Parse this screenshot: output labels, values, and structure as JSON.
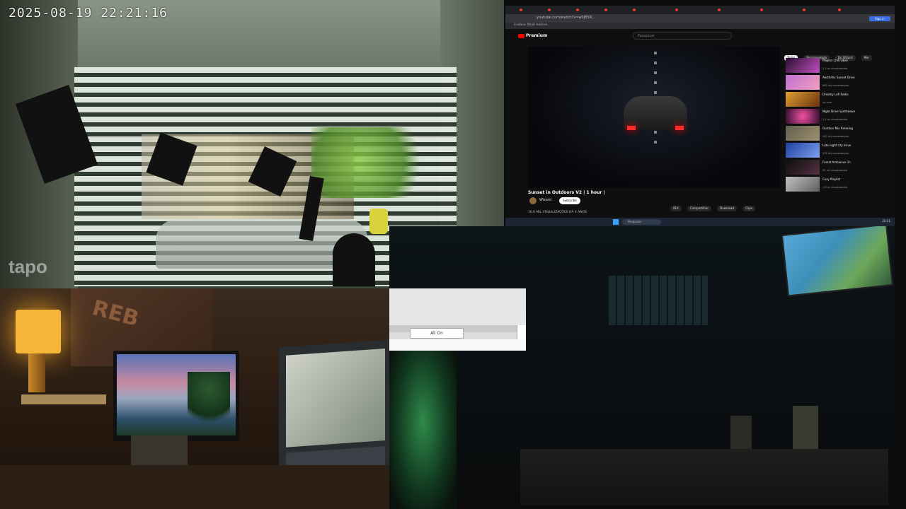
{
  "cctv": {
    "timestamp": "2025-08-19  22:21:16",
    "watermark": "tapo"
  },
  "browser": {
    "url": "youtube.com/watch?v=w0JB5R...",
    "bookmark_bar": "Endless 8ball    Hotline...",
    "top_right_button": "Sign in",
    "youtube": {
      "logo": "Premium",
      "search_placeholder": "Pesquisar",
      "video_title": "Sunset in Outdoors V2 | 1 hour |",
      "channel": "Wizard",
      "subscribe_label": "Subscribe",
      "actions": [
        "81K",
        "Compartilhar",
        "Download",
        "Clipe"
      ],
      "description": "16.6 MIL VISUALIZAÇÕES  HÁ 4 ANOS",
      "chips": [
        "Todos",
        "Recomendado",
        "Do Wizard",
        "Mix"
      ],
      "recommendations": [
        {
          "title": "Playlist Chill vibes",
          "meta": "2,1 mi visualizações"
        },
        {
          "title": "Aesthetic Sunset Drive",
          "meta": "869 mil visualizações"
        },
        {
          "title": "Dreamy Lofi Radio",
          "meta": "Ao vivo"
        },
        {
          "title": "Night Drive Synthwave",
          "meta": "1,2 mi visualizações"
        },
        {
          "title": "Outdoor Mix Relaxing",
          "meta": "540 mil visualizações"
        },
        {
          "title": "Late night city drive",
          "meta": "318 mil visualizações"
        },
        {
          "title": "Forest Ambience 1h",
          "meta": "92 mil visualizações"
        },
        {
          "title": "Cozy Playlist",
          "meta": "1,8 mi visualizações"
        }
      ]
    },
    "taskbar": {
      "search_placeholder": "Pesquisar",
      "clock": "22:21"
    }
  },
  "control_window": {
    "button_label": "All On"
  },
  "room": {
    "poster_text": "REB"
  }
}
